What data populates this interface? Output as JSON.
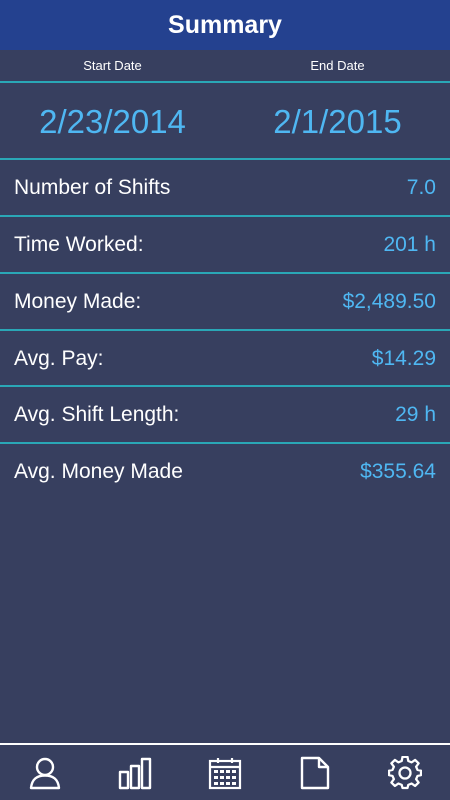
{
  "header": {
    "title": "Summary"
  },
  "date_range": {
    "start_label": "Start Date",
    "end_label": "End Date",
    "start_value": "2/23/2014",
    "end_value": "2/1/2015"
  },
  "stats": [
    {
      "label": "Number of Shifts",
      "value": "7.0"
    },
    {
      "label": "Time Worked:",
      "value": "201 h"
    },
    {
      "label": "Money Made:",
      "value": "$2,489.50"
    },
    {
      "label": "Avg. Pay:",
      "value": "$14.29"
    },
    {
      "label": "Avg. Shift Length:",
      "value": "29 h"
    },
    {
      "label": "Avg. Money Made",
      "value": "$355.64"
    }
  ],
  "bottom_nav": [
    {
      "icon": "person-icon"
    },
    {
      "icon": "bar-chart-icon"
    },
    {
      "icon": "calendar-icon"
    },
    {
      "icon": "document-icon"
    },
    {
      "icon": "gear-icon"
    }
  ],
  "colors": {
    "title_bar": "#24418f",
    "background": "#373f5f",
    "accent_text": "#4fb7f2",
    "divider": "#2aa7b6"
  }
}
